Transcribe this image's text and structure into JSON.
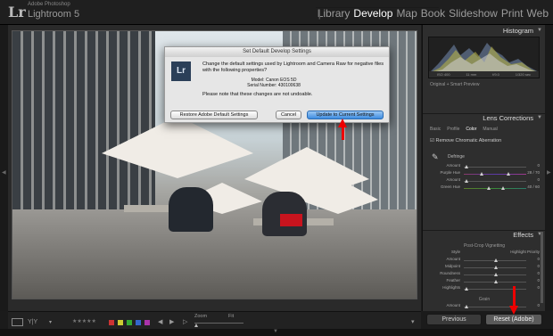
{
  "app": {
    "logo_glyph": "Lr",
    "vendor": "Adobe Photoshop",
    "name": "Lightroom 5"
  },
  "modules": [
    "Library",
    "Develop",
    "Map",
    "Book",
    "Slideshow",
    "Print",
    "Web"
  ],
  "active_module": "Develop",
  "dialog": {
    "title": "Set Default Develop Settings",
    "logo": "Lr",
    "message": "Change the default settings used by Lightroom and Camera Raw for negative files with the following properties?",
    "model_label": "Model:",
    "model_value": "Canon EOS 5D",
    "serial_label": "Serial Number:",
    "serial_value": "430100638",
    "note": "Please note that these changes are not undoable.",
    "btn_restore": "Restore Adobe Default Settings",
    "btn_cancel": "Cancel",
    "btn_update": "Update to Current Settings"
  },
  "histogram": {
    "title": "Histogram",
    "caption": [
      "ISO 400",
      "11 mm",
      "f/9.0",
      "1/320 sec"
    ],
    "preview_label": "Original + Smart Preview"
  },
  "lens": {
    "title": "Lens Corrections",
    "tabs": [
      "Basic",
      "Profile",
      "Color",
      "Manual"
    ],
    "active_tab": "Color",
    "checkbox_label": "Remove Chromatic Aberration",
    "defringe_label": "Defringe",
    "sliders": [
      {
        "label": "Amount",
        "value": "0"
      },
      {
        "label": "Purple Hue",
        "value": "28 / 70"
      },
      {
        "label": "Amount",
        "value": "0"
      },
      {
        "label": "Green Hue",
        "value": "40 / 60"
      }
    ]
  },
  "effects": {
    "title": "Effects",
    "vignette_label": "Post-Crop Vignetting",
    "style_label": "Style",
    "style_value": "Highlight Priority",
    "sliders": [
      {
        "label": "Amount",
        "value": "0"
      },
      {
        "label": "Midpoint",
        "value": "0"
      },
      {
        "label": "Roundness",
        "value": "0"
      },
      {
        "label": "Feather",
        "value": "0"
      },
      {
        "label": "Highlights",
        "value": "0"
      }
    ],
    "grain_label": "Grain",
    "grain_amount_label": "Amount",
    "grain_amount_value": "0"
  },
  "toolbar": {
    "zoom_label": "Zoom",
    "fit_label": "Fit"
  },
  "buttons": {
    "previous": "Previous",
    "reset": "Reset (Adobe)"
  },
  "colors": {
    "accent_red": "#e00000",
    "dialog_primary": "#3d8ce0",
    "panel_bg": "#2e2e2e"
  }
}
